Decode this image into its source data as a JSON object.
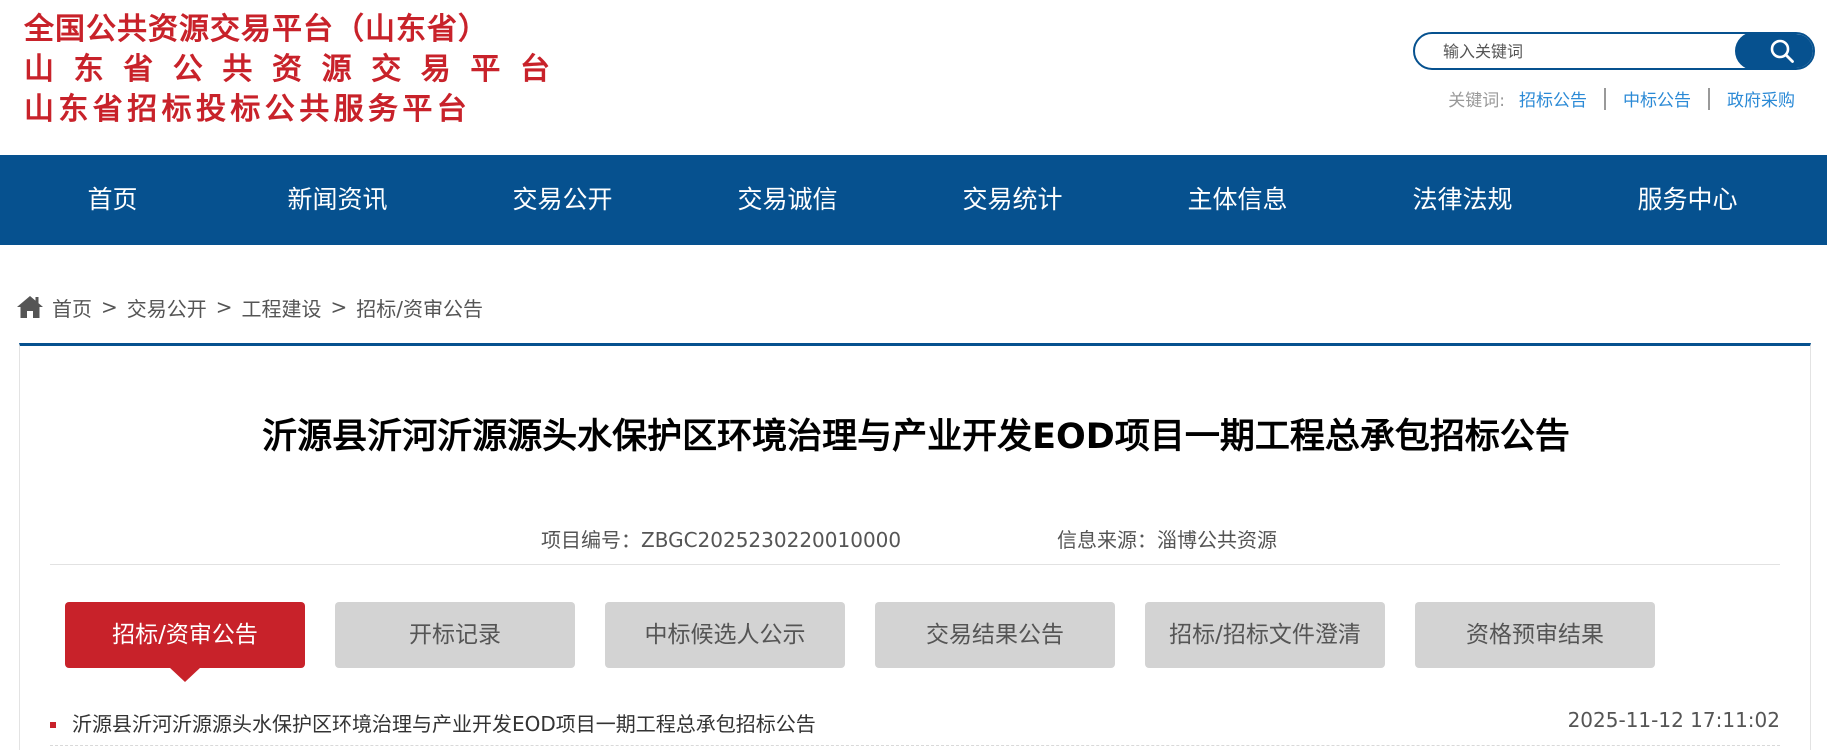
{
  "header": {
    "logo_lines": [
      "全国公共资源交易平台（山东省）",
      "山东省公共资源交易平台",
      "山东省招标投标公共服务平台"
    ],
    "search": {
      "placeholder": "输入关键词"
    },
    "keywords": {
      "label": "关键词:",
      "links": [
        "招标公告",
        "中标公告",
        "政府采购"
      ]
    }
  },
  "nav": {
    "items": [
      "首页",
      "新闻资讯",
      "交易公开",
      "交易诚信",
      "交易统计",
      "主体信息",
      "法律法规",
      "服务中心"
    ]
  },
  "breadcrumb": {
    "items": [
      "首页",
      "交易公开",
      "工程建设",
      "招标/资审公告"
    ],
    "separator": ">"
  },
  "article": {
    "title": "沂源县沂河沂源源头水保护区环境治理与产业开发EOD项目一期工程总承包招标公告",
    "project_no_label": "项目编号：",
    "project_no": "ZBGC2025230220010000",
    "source_label": "信息来源：",
    "source": "淄博公共资源"
  },
  "tabs": [
    "招标/资审公告",
    "开标记录",
    "中标候选人公示",
    "交易结果公告",
    "招标/招标文件澄清",
    "资格预审结果"
  ],
  "active_tab": "招标/资审公告",
  "list": [
    {
      "title": "沂源县沂河沂源源头水保护区环境治理与产业开发EOD项目一期工程总承包招标公告",
      "date": "2025-11-12 17:11:02"
    }
  ],
  "colors": {
    "brand_blue": "#06518f",
    "accent_red": "#c8222a",
    "link_blue": "#2b8ad6"
  }
}
